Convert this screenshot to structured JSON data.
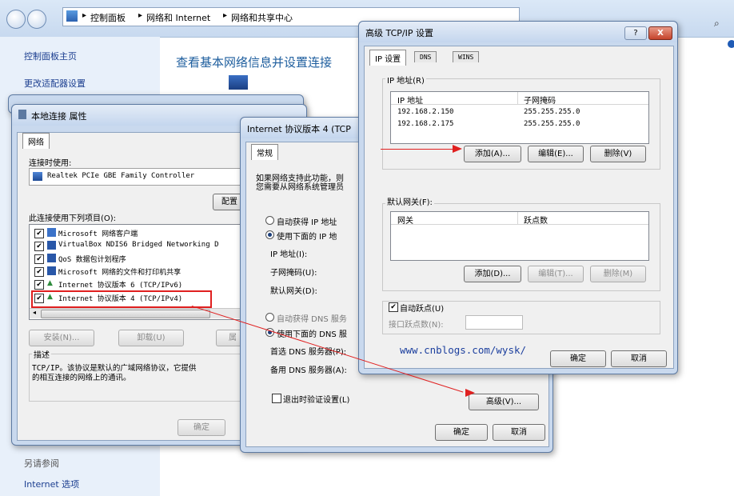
{
  "explorer": {
    "breadcrumb": [
      "控制面板",
      "网络和 Internet",
      "网络和共享中心"
    ],
    "sidebar_links": [
      "控制面板主页",
      "更改适配器设置"
    ],
    "see_also_title": "另请参阅",
    "see_also_items": [
      "Internet 选项"
    ],
    "heading": "查看基本网络信息并设置连接"
  },
  "props_dialog": {
    "title": "本地连接 属性",
    "tab": "网络",
    "connect_using_label": "连接时使用:",
    "adapter_name": "Realtek PCIe GBE Family Controller",
    "configure_button": "配置",
    "items_label": "此连接使用下列项目(O):",
    "items": [
      {
        "label": "Microsoft 网络客户端",
        "checked": true
      },
      {
        "label": "VirtualBox NDIS6 Bridged Networking D",
        "checked": true
      },
      {
        "label": "QoS 数据包计划程序",
        "checked": true
      },
      {
        "label": "Microsoft 网络的文件和打印机共享",
        "checked": true
      },
      {
        "label": "Internet 协议版本 6 (TCP/IPv6)",
        "checked": true
      },
      {
        "label": "Internet 协议版本 4 (TCP/IPv4)",
        "checked": true
      }
    ],
    "install_button": "安装(N)...",
    "uninstall_button": "卸载(U)",
    "properties_button": "属",
    "description_label": "描述",
    "description_text_1": "TCP/IP。该协议是默认的广域网络协议，它提供",
    "description_text_2": "的相互连接的网络上的通讯。",
    "ok_button": "确定"
  },
  "ipv4_dialog": {
    "title": "Internet 协议版本 4 (TCP",
    "tab": "常规",
    "intro_1": "如果网络支持此功能，则",
    "intro_2": "您需要从网络系统管理员",
    "auto_ip": "自动获得 IP 地址",
    "manual_ip": "使用下面的 IP 地",
    "ip_label": "IP 地址(I):",
    "mask_label": "子网掩码(U):",
    "gateway_label": "默认网关(D):",
    "auto_dns": "自动获得 DNS 服务",
    "manual_dns": "使用下面的 DNS 服",
    "preferred_dns": "首选 DNS 服务器(P):",
    "alternate_dns": "备用 DNS 服务器(A):",
    "validate_label": "退出时验证设置(L)",
    "advanced_button": "高级(V)...",
    "ok_button": "确定",
    "cancel_button": "取消"
  },
  "advanced_dialog": {
    "title": "高级 TCP/IP 设置",
    "help_glyph": "?",
    "close_glyph": "X",
    "tabs": [
      "IP 设置",
      "DNS",
      "WINS"
    ],
    "ip_group_label": "IP 地址(R)",
    "ip_col_header": "IP 地址",
    "mask_col_header": "子网掩码",
    "ip_rows": [
      {
        "ip": "192.168.2.150",
        "mask": "255.255.255.0"
      },
      {
        "ip": "192.168.2.175",
        "mask": "255.255.255.0"
      }
    ],
    "ip_add_button": "添加(A)...",
    "ip_edit_button": "编辑(E)...",
    "ip_delete_button": "删除(V)",
    "gateway_group_label": "默认网关(F):",
    "gw_col_header": "网关",
    "metric_col_header": "跃点数",
    "gw_add_button": "添加(D)...",
    "gw_edit_button": "编辑(T)...",
    "gw_delete_button": "删除(M)",
    "auto_metric_label": "自动跃点(U)",
    "interface_metric_label": "接口跃点数(N):",
    "watermark": "www.cnblogs.com/wysk/",
    "ok_button": "确定",
    "cancel_button": "取消"
  },
  "colors": {
    "annotation_red": "#e02020",
    "watermark_blue": "#1c3f9e"
  }
}
